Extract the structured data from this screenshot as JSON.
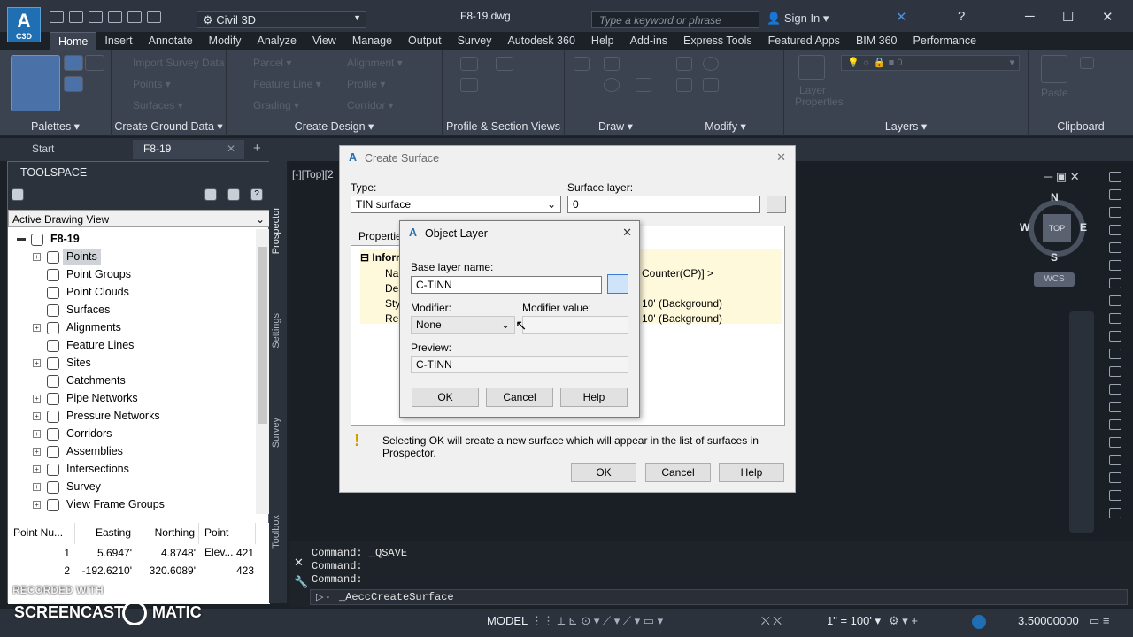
{
  "app": {
    "logo_text": "A",
    "logo_sub": "C3D",
    "workspace": "Civil 3D",
    "doc_title": "F8-19.dwg",
    "search_placeholder": "Type a keyword or phrase",
    "sign_in": "Sign In"
  },
  "ribbon_tabs": [
    "Home",
    "Insert",
    "Annotate",
    "Modify",
    "Analyze",
    "View",
    "Manage",
    "Output",
    "Survey",
    "Autodesk 360",
    "Help",
    "Add-ins",
    "Express Tools",
    "Featured Apps",
    "BIM 360",
    "Performance"
  ],
  "ribbon": {
    "ground_data_items": [
      "Import Survey Data",
      "Points",
      "Surfaces"
    ],
    "design_items": [
      "Parcel",
      "Feature Line",
      "Grading",
      "Alignment",
      "Profile",
      "Corridor"
    ],
    "layer_value": "0",
    "layer_properties": "Layer Properties",
    "paste": "Paste",
    "panels": [
      "Palettes",
      "Create Ground Data",
      "Create Design",
      "Profile & Section Views",
      "Draw",
      "Modify",
      "Layers",
      "Clipboard"
    ]
  },
  "file_tabs": [
    "Start",
    "F8-19"
  ],
  "toolspace": {
    "header": "TOOLSPACE",
    "view_dropdown": "Active Drawing View",
    "root": "F8-19",
    "items": [
      "Points",
      "Point Groups",
      "Point Clouds",
      "Surfaces",
      "Alignments",
      "Feature Lines",
      "Sites",
      "Catchments",
      "Pipe Networks",
      "Pressure Networks",
      "Corridors",
      "Assemblies",
      "Intersections",
      "Survey",
      "View Frame Groups"
    ],
    "side_tabs": [
      "Prospector",
      "Settings",
      "Survey",
      "Toolbox"
    ],
    "grid_headers": [
      "Point Nu...",
      "Easting",
      "Northing",
      "Point Elev..."
    ],
    "grid_rows": [
      [
        "1",
        "5.6947'",
        "4.8748'",
        "421"
      ],
      [
        "2",
        "-192.6210'",
        "320.6089'",
        "423"
      ]
    ]
  },
  "viewport": {
    "label": "[-][Top][2",
    "compass": {
      "n": "N",
      "s": "S",
      "e": "E",
      "w": "W",
      "top": "TOP"
    },
    "wcs": "WCS"
  },
  "create_surface": {
    "title": "Create Surface",
    "type_label": "Type:",
    "type_value": "TIN surface",
    "layer_label": "Surface layer:",
    "layer_value": "0",
    "properties_tab": "Properties",
    "info_header": "Inform",
    "rows": [
      "Nan",
      "Des",
      "Sty",
      "Ren"
    ],
    "values": [
      "Counter(CP)] >",
      "",
      "10' (Background)",
      "10' (Background)"
    ],
    "info_text": "Selecting OK will create a new surface which will appear in the list of surfaces in Prospector.",
    "ok": "OK",
    "cancel": "Cancel",
    "help": "Help"
  },
  "object_layer": {
    "title": "Object Layer",
    "base_label": "Base layer name:",
    "base_value": "C-TINN",
    "modifier_label": "Modifier:",
    "modifier_value": "None",
    "modval_label": "Modifier value:",
    "modval_value": "",
    "preview_label": "Preview:",
    "preview_value": "C-TINN",
    "ok": "OK",
    "cancel": "Cancel",
    "help": "Help"
  },
  "command": {
    "lines": [
      "Command:  _QSAVE",
      "Command:",
      "Command:"
    ],
    "input": "_AeccCreateSurface"
  },
  "status": {
    "model": "MODEL",
    "scale": "1\" = 100'",
    "value": "3.50000000"
  },
  "watermark": {
    "recorded_with": "RECORDED WITH",
    "brand_left": "SCREENCAST",
    "brand_right": "MATIC"
  },
  "colors": {
    "accent": "#1f6fb2",
    "ribbon": "#3b4250",
    "dialog": "#f0f0f0",
    "canvas": "#1a1f26"
  }
}
